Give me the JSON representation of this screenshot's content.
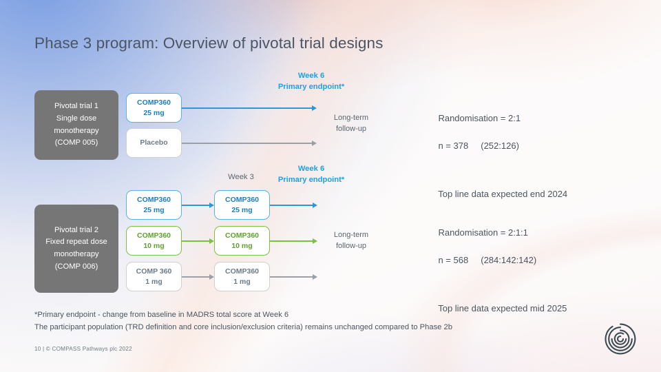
{
  "slide": {
    "title": "Phase 3 program: Overview of pivotal trial designs",
    "footer": "10  |  © COMPASS Pathways plc 2022",
    "logo_icon": "compass-spiral-logo-icon"
  },
  "colors": {
    "blue_text": "#1b7fc4",
    "blue_border": "#56b3e8",
    "blue_arrow": "#2b96d8",
    "blue_caption": "#1ba2e6",
    "green": "#7cc043",
    "green_text": "#5fa22c",
    "grey_box_border": "#cfcfcf",
    "grey_text": "#6b7b88",
    "grey_arrow": "#9aa0a6",
    "label_block": "#767676",
    "title_text": "#4b5563"
  },
  "trial1": {
    "label": {
      "line1": "Pivotal trial 1",
      "line2": "Single dose",
      "line3": "monotherapy",
      "line4": "(COMP 005)"
    },
    "arms": [
      {
        "name": "comp360-25mg",
        "line1": "COMP360",
        "line2": "25 mg",
        "style": "blue"
      },
      {
        "name": "placebo",
        "line1": "Placebo",
        "line2": "",
        "style": "grey"
      }
    ],
    "caption": {
      "line1": "Week 6",
      "line2": "Primary endpoint*"
    },
    "followup": {
      "line1": "Long-term",
      "line2": "follow-up"
    },
    "stats": {
      "randomisation": "Randomisation = 2:1",
      "n": "n = 378     (252:126)",
      "topline": "Top line data expected end 2024"
    }
  },
  "trial2": {
    "label": {
      "line1": "Pivotal trial 2",
      "line2": "Fixed repeat dose",
      "line3": "monotherapy",
      "line4": "(COMP 006)"
    },
    "caption_week3": "Week 3",
    "caption_week6": {
      "line1": "Week 6",
      "line2": "Primary endpoint*"
    },
    "arms": [
      {
        "name": "comp360-25mg",
        "style": "blue",
        "dose1": {
          "line1": "COMP360",
          "line2": "25 mg"
        },
        "dose2": {
          "line1": "COMP360",
          "line2": "25 mg"
        }
      },
      {
        "name": "comp360-10mg",
        "style": "green",
        "dose1": {
          "line1": "COMP360",
          "line2": "10 mg"
        },
        "dose2": {
          "line1": "COMP360",
          "line2": "10 mg"
        }
      },
      {
        "name": "comp360-1mg",
        "style": "grey",
        "dose1": {
          "line1": "COMP 360",
          "line2": "1 mg"
        },
        "dose2": {
          "line1": "COMP360",
          "line2": "1 mg"
        }
      }
    ],
    "followup": {
      "line1": "Long-term",
      "line2": "follow-up"
    },
    "stats": {
      "randomisation": "Randomisation = 2:1:1",
      "n": "n = 568     (284:142:142)",
      "topline": "Top line data expected mid 2025"
    }
  },
  "footnotes": {
    "line1": "*Primary endpoint - change from baseline in MADRS total score at Week 6",
    "line2": "The participant population (TRD definition and core inclusion/exclusion criteria) remains unchanged compared to Phase 2b"
  }
}
